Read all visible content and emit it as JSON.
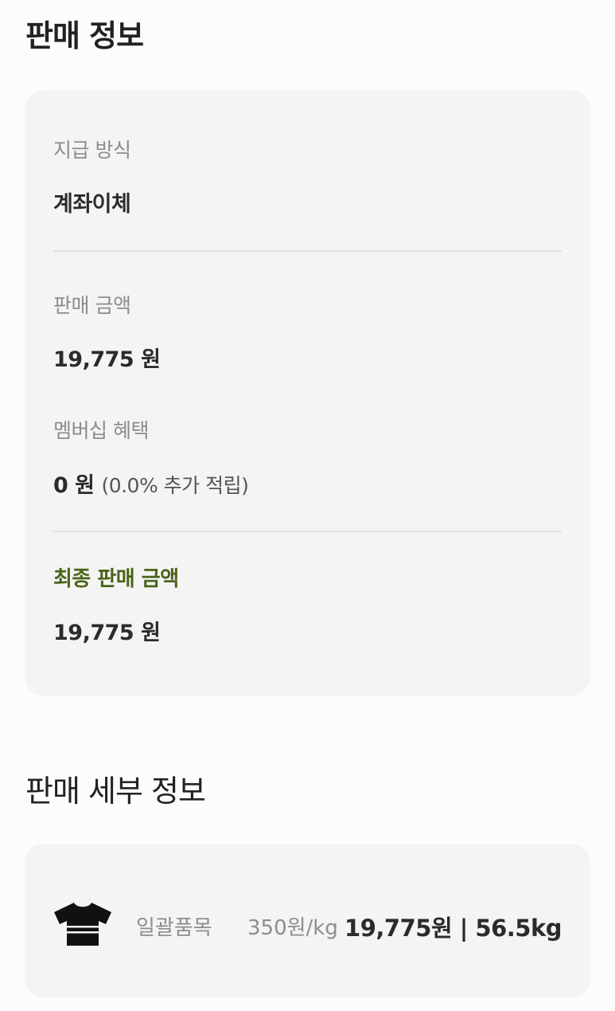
{
  "sales_info": {
    "title": "판매 정보",
    "payment_method_label": "지급 방식",
    "payment_method_value": "계좌이체",
    "sale_amount_label": "판매 금액",
    "sale_amount_value": "19,775 원",
    "membership_benefit_label": "멤버십 혜택",
    "membership_benefit_value": "0 원",
    "membership_benefit_note": "(0.0% 추가 적립)",
    "final_amount_label": "최종 판매 금액",
    "final_amount_value": "19,775 원",
    "accent_color": "#4a6418"
  },
  "sales_detail": {
    "title": "판매 세부 정보",
    "items": [
      {
        "icon": "tshirt-icon",
        "category": "일괄품목",
        "rate": "350원/kg",
        "summary": "19,775원 | 56.5kg"
      }
    ]
  }
}
